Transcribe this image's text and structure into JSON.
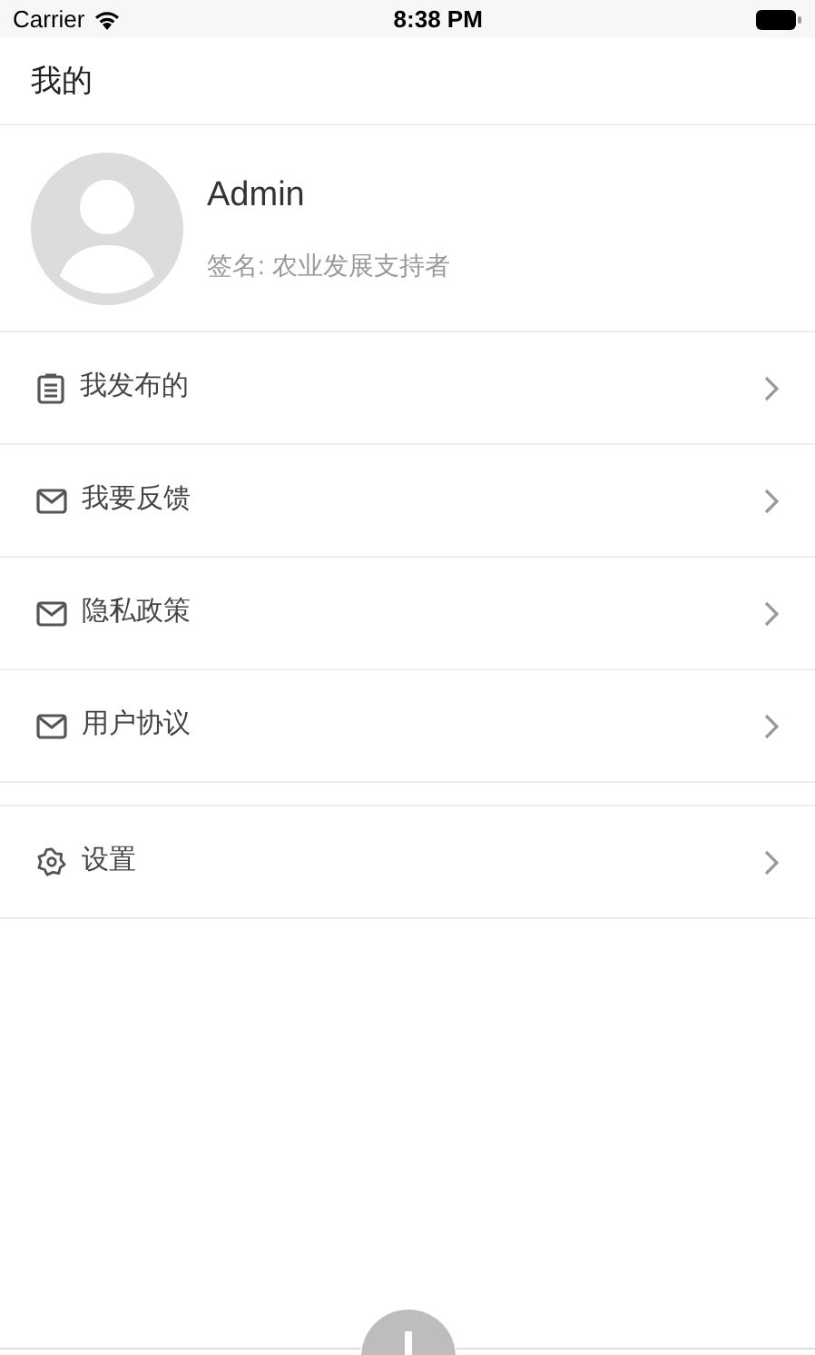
{
  "status_bar": {
    "carrier": "Carrier",
    "time": "8:38 PM"
  },
  "header": {
    "title": "我的"
  },
  "profile": {
    "name": "Admin",
    "signature": "签名: 农业发展支持者"
  },
  "menu_groups": [
    {
      "items": [
        {
          "label": "我发布的",
          "kind": "clipboard"
        },
        {
          "label": "我要反馈",
          "kind": "mail"
        },
        {
          "label": "隐私政策",
          "kind": "mail"
        },
        {
          "label": "用户协议",
          "kind": "mail"
        }
      ]
    },
    {
      "items": [
        {
          "label": "设置",
          "kind": "gear"
        }
      ]
    }
  ]
}
